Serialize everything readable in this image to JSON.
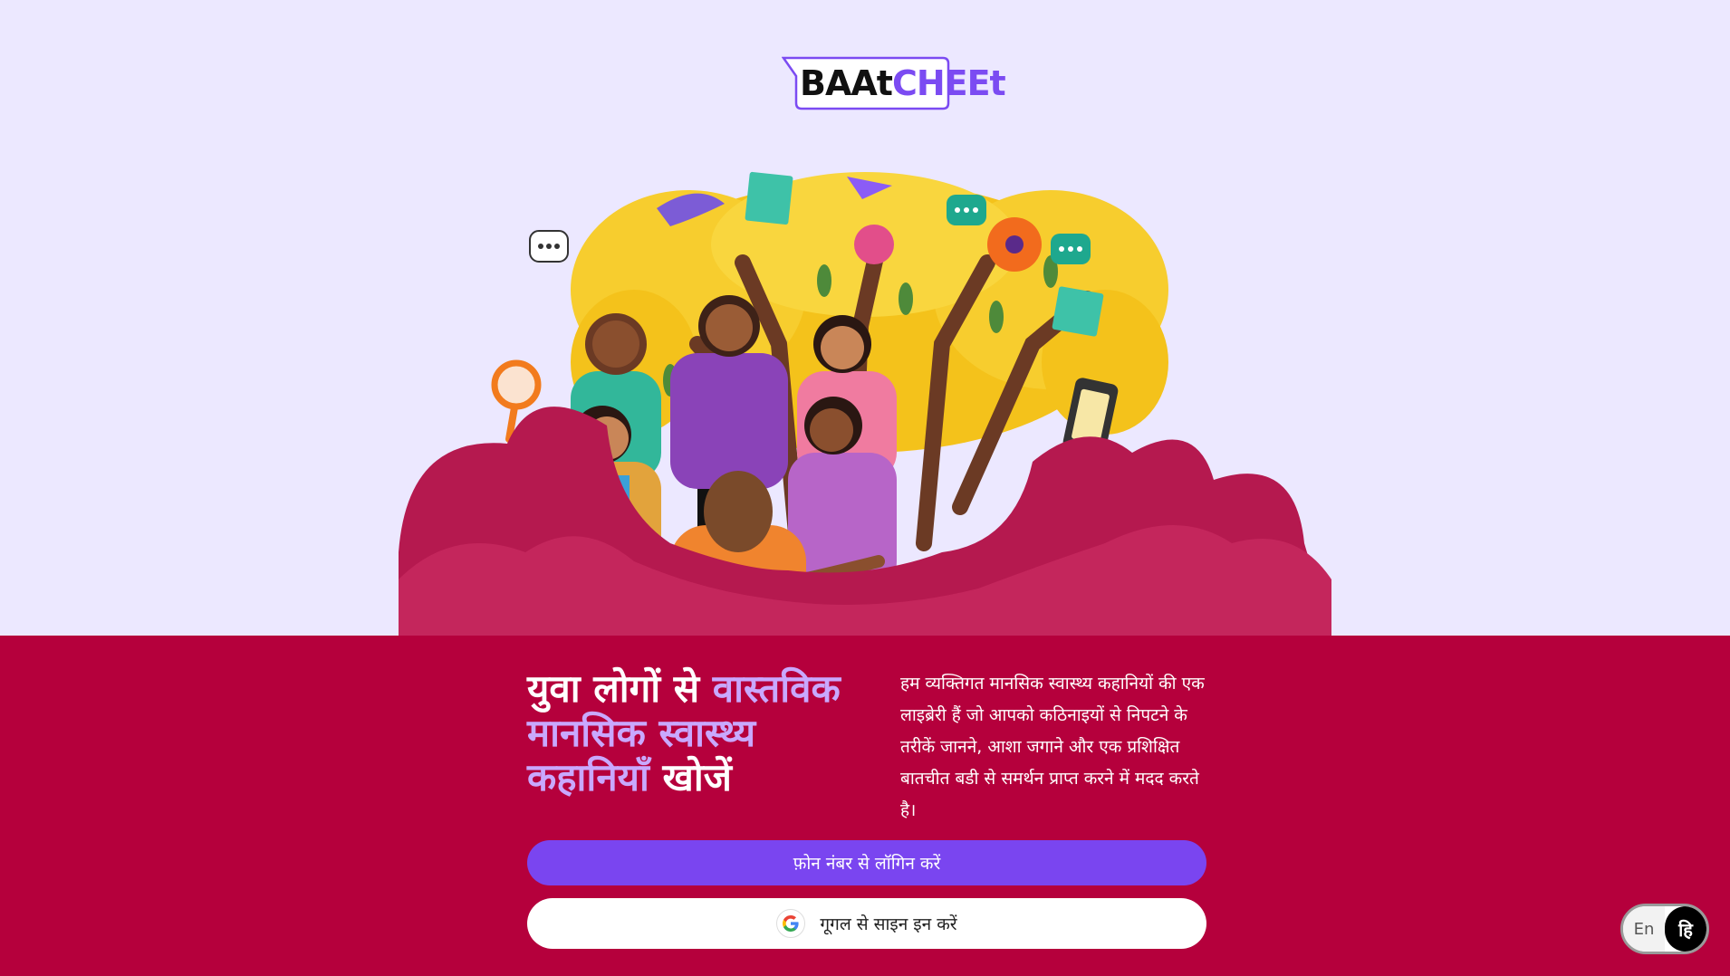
{
  "logo": {
    "part1": "BAAt",
    "part2": "CHEEt"
  },
  "illustration": {
    "description_icon": "people-hugging-under-tree-illustration"
  },
  "hero": {
    "headline_white_1": "युवा लोगों से ",
    "headline_purple": "वास्तविक मानसिक स्वास्थ्य कहानियाँ",
    "headline_white_2": " खोजें",
    "description": "हम व्यक्तिगत मानसिक स्वास्थ्य कहानियों की एक लाइब्रेरी हैं जो आपको कठिनाइयों से निपटने के तरीकें जानने, आशा जगाने और एक प्रशिक्षित बातचीत बडी से समर्थन प्राप्त करने में मदद करते है।"
  },
  "buttons": {
    "phone_login": "फ़ोन नंबर से लॉगिन करें",
    "google_signin": "गूगल से साइन इन करें"
  },
  "language": {
    "en": "En",
    "hi": "हि"
  },
  "colors": {
    "background": "#ECE8FF",
    "bottom_panel": "#B5003C",
    "accent_purple": "#7A45F0",
    "headline_purple": "#C9A8FF"
  }
}
